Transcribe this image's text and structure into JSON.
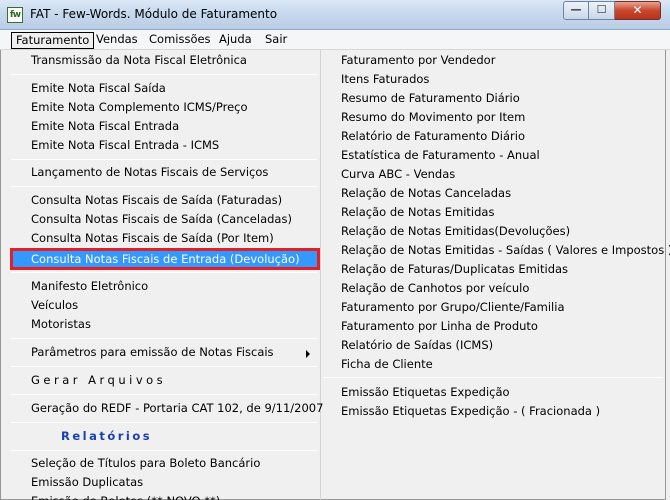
{
  "window": {
    "app_icon": "fw",
    "title": "FAT - Few-Words. Módulo de Faturamento",
    "minimize_icon": "minimize-icon",
    "maximize_icon": "maximize-icon",
    "close_icon": "close-icon",
    "minimize_glyph": "—",
    "maximize_glyph": "☐",
    "close_glyph": "✕"
  },
  "menubar": [
    "Faturamento",
    "Vendas",
    "Comissões",
    "Ajuda",
    "Sair"
  ],
  "left_menu": {
    "transmissao": "Transmissão da Nota Fiscal Eletrônica",
    "emite_saida": "Emite Nota Fiscal Saída",
    "emite_complemento": "Emite Nota Complemento ICMS/Preço",
    "emite_entrada": "Emite Nota Fiscal Entrada",
    "emite_entrada_icms": "Emite Nota Fiscal Entrada - ICMS",
    "lancamento_servicos": "Lançamento de Notas Fiscais de Serviços",
    "consulta_faturadas": "Consulta Notas Fiscais de Saída (Faturadas)",
    "consulta_canceladas": "Consulta Notas Fiscais de Saída (Canceladas)",
    "consulta_por_item": "Consulta Notas Fiscais de Saída (Por Item)",
    "consulta_entrada_devolucao": "Consulta Notas Fiscais de Entrada (Devolução)",
    "manifesto": "Manifesto Eletrônico",
    "veiculos": "Veículos",
    "motoristas": "Motoristas",
    "parametros": "Parâmetros para emissão de Notas Fiscais",
    "gerar_arquivos": "Gerar Arquivos",
    "geracao_redf": "Geração do REDF - Portaria CAT 102, de 9/11/2007",
    "relatorios": "Relatórios",
    "selecao_titulos": "Seleção de Títulos para Boleto Bancário",
    "emissao_duplicatas": "Emissão Duplicatas",
    "emissao_boletos_partial": "Emissão de Boletos (** NOVO **)"
  },
  "right_menu": [
    "Faturamento por Vendedor",
    "Itens Faturados",
    "Resumo de Faturamento Diário",
    "Resumo do Movimento por Item",
    "Relatório de Faturamento Diário",
    "Estatística de Faturamento - Anual",
    "Curva ABC - Vendas",
    "Relação de Notas Canceladas",
    "Relação de Notas Emitidas",
    "Relação de Notas Emitidas(Devoluções)",
    "Relação de Notas Emitidas - Saídas ( Valores e Impostos )",
    "Relação de Faturas/Duplicatas Emitidas",
    "Relação de Canhotos por veículo",
    "Faturamento por Grupo/Cliente/Familia",
    "Faturamento por Linha de Produto",
    "Relatório de  Saídas (ICMS)",
    "Ficha de Cliente"
  ],
  "right_menu_bottom": [
    "Emissão Etiquetas Expedição",
    "Emissão Etiquetas Expedição - ( Fracionada )"
  ],
  "colors": {
    "highlight": "#3399ff",
    "highlight_border": "#e11f25",
    "section_text": "#1a3fb0"
  }
}
